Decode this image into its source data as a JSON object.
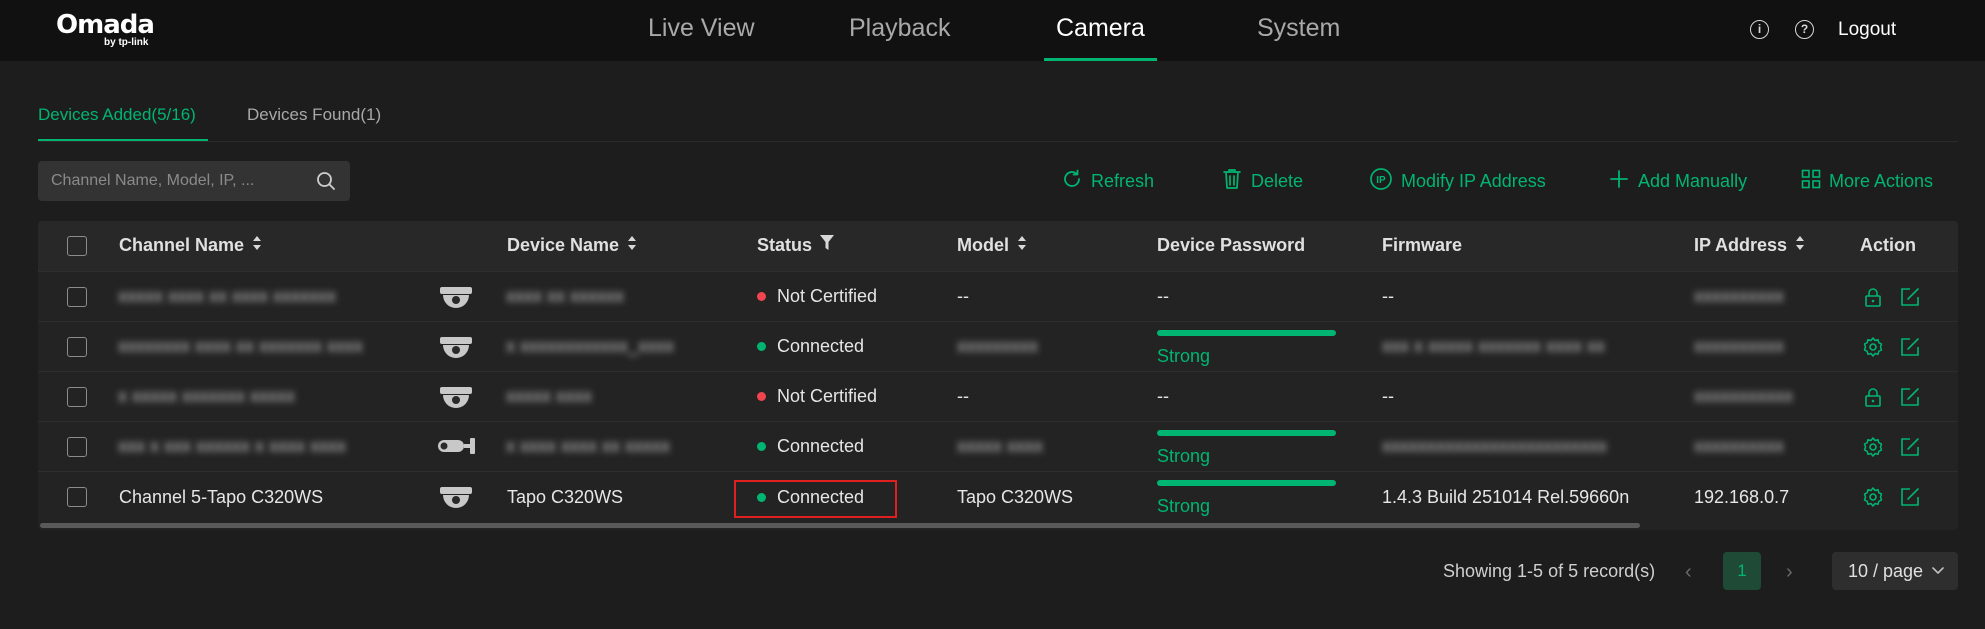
{
  "brand": {
    "name": "Omada",
    "sub": "by tp-link"
  },
  "nav": {
    "tabs": [
      "Live View",
      "Playback",
      "Camera",
      "System"
    ],
    "active": "Camera",
    "info_icon": "info-icon",
    "help_icon": "help-icon",
    "logout": "Logout"
  },
  "subtabs": {
    "added": "Devices Added(5/16)",
    "found": "Devices Found(1)"
  },
  "search": {
    "placeholder": "Channel Name, Model, IP, ...",
    "value": ""
  },
  "toolbar": {
    "refresh": "Refresh",
    "delete": "Delete",
    "modify_ip": "Modify IP Address",
    "add_manually": "Add Manually",
    "more_actions": "More Actions"
  },
  "table": {
    "headers": {
      "channel_name": "Channel Name",
      "device_name": "Device Name",
      "status": "Status",
      "model": "Model",
      "device_password": "Device Password",
      "firmware": "Firmware",
      "ip_address": "IP Address",
      "action": "Action"
    },
    "rows": [
      {
        "channel": "",
        "device": "",
        "camera_icon": "dome-camera-icon",
        "status": "Not Certified",
        "status_color": "#f0454f",
        "model": "--",
        "password": "--",
        "firmware": "--",
        "ip": "",
        "actions": [
          "lock-icon",
          "edit-icon"
        ]
      },
      {
        "channel": "",
        "device": "",
        "camera_icon": "dome-camera-icon",
        "status": "Connected",
        "status_color": "#00b572",
        "model": "",
        "password": "Strong",
        "password_level": 1.0,
        "firmware": "",
        "ip": "",
        "actions": [
          "gear-icon",
          "edit-icon"
        ]
      },
      {
        "channel": "",
        "device": "",
        "camera_icon": "dome-camera-icon",
        "status": "Not Certified",
        "status_color": "#f0454f",
        "model": "--",
        "password": "--",
        "firmware": "--",
        "ip": "",
        "actions": [
          "lock-icon",
          "edit-icon"
        ]
      },
      {
        "channel": "",
        "device": "",
        "camera_icon": "bullet-camera-icon",
        "status": "Connected",
        "status_color": "#00b572",
        "model": "",
        "password": "Strong",
        "password_level": 1.0,
        "firmware": "",
        "ip": "",
        "actions": [
          "gear-icon",
          "edit-icon"
        ]
      },
      {
        "channel": "Channel 5-Tapo C320WS",
        "device": "Tapo C320WS",
        "camera_icon": "dome-camera-icon",
        "status": "Connected",
        "status_color": "#00b572",
        "model": "Tapo C320WS",
        "password": "Strong",
        "password_level": 1.0,
        "firmware": "1.4.3 Build 251014 Rel.59660n",
        "ip": "192.168.0.7",
        "actions": [
          "gear-icon",
          "edit-icon"
        ]
      }
    ]
  },
  "pagination": {
    "info": "Showing 1-5 of 5 record(s)",
    "current_page": "1",
    "page_size": "10 / page"
  },
  "colors": {
    "accent": "#00b572",
    "error": "#f0454f",
    "background": "#1d1d1d",
    "topbar": "#111111"
  }
}
